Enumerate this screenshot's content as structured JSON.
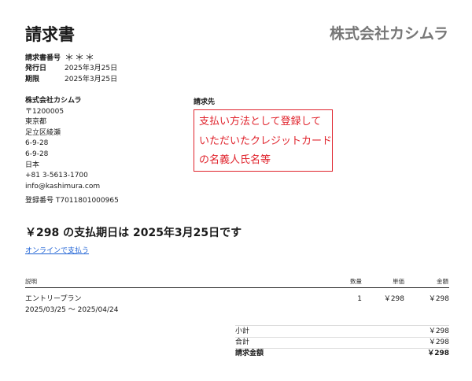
{
  "invoice": {
    "title": "請求書",
    "company_name_header": "株式会社カシムラ",
    "invoice_number_label": "請求書番号",
    "invoice_number_value": "＊＊＊",
    "issue_date_label": "発行日",
    "issue_date_value": "2025年3月25日",
    "due_date_label": "期限",
    "due_date_value": "2025年3月25日"
  },
  "sender": {
    "name": "株式会社カシムラ",
    "lines": [
      "〒1200005",
      "東京都",
      "足立区綾瀬",
      "6-9-28",
      "6-9-28",
      "日本",
      "+81 3-5613-1700",
      "info@kashimura.com"
    ],
    "registration": "登録番号 T7011801000965"
  },
  "bill_to": {
    "label": "請求先",
    "note_lines": [
      "支払い方法として登録して",
      "いただいたクレジットカード",
      "の名義人氏名等"
    ]
  },
  "due_summary": "￥298 の支払期日は 2025年3月25日です",
  "pay_online_link": "オンラインで支払う",
  "table": {
    "headers": {
      "description": "説明",
      "quantity": "数量",
      "unit_price": "単価",
      "amount": "金額"
    },
    "rows": [
      {
        "description": "エントリープラン",
        "period": "2025/03/25 ～ 2025/04/24",
        "quantity": "1",
        "unit_price": "￥298",
        "amount": "￥298"
      }
    ]
  },
  "totals": {
    "subtotal_label": "小計",
    "subtotal_value": "￥298",
    "total_label": "合計",
    "total_value": "￥298",
    "billed_label": "請求金額",
    "billed_value": "￥298"
  },
  "colors": {
    "accent_red": "#e0242d",
    "link_blue": "#1a5fd4",
    "header_gray": "#777777"
  }
}
